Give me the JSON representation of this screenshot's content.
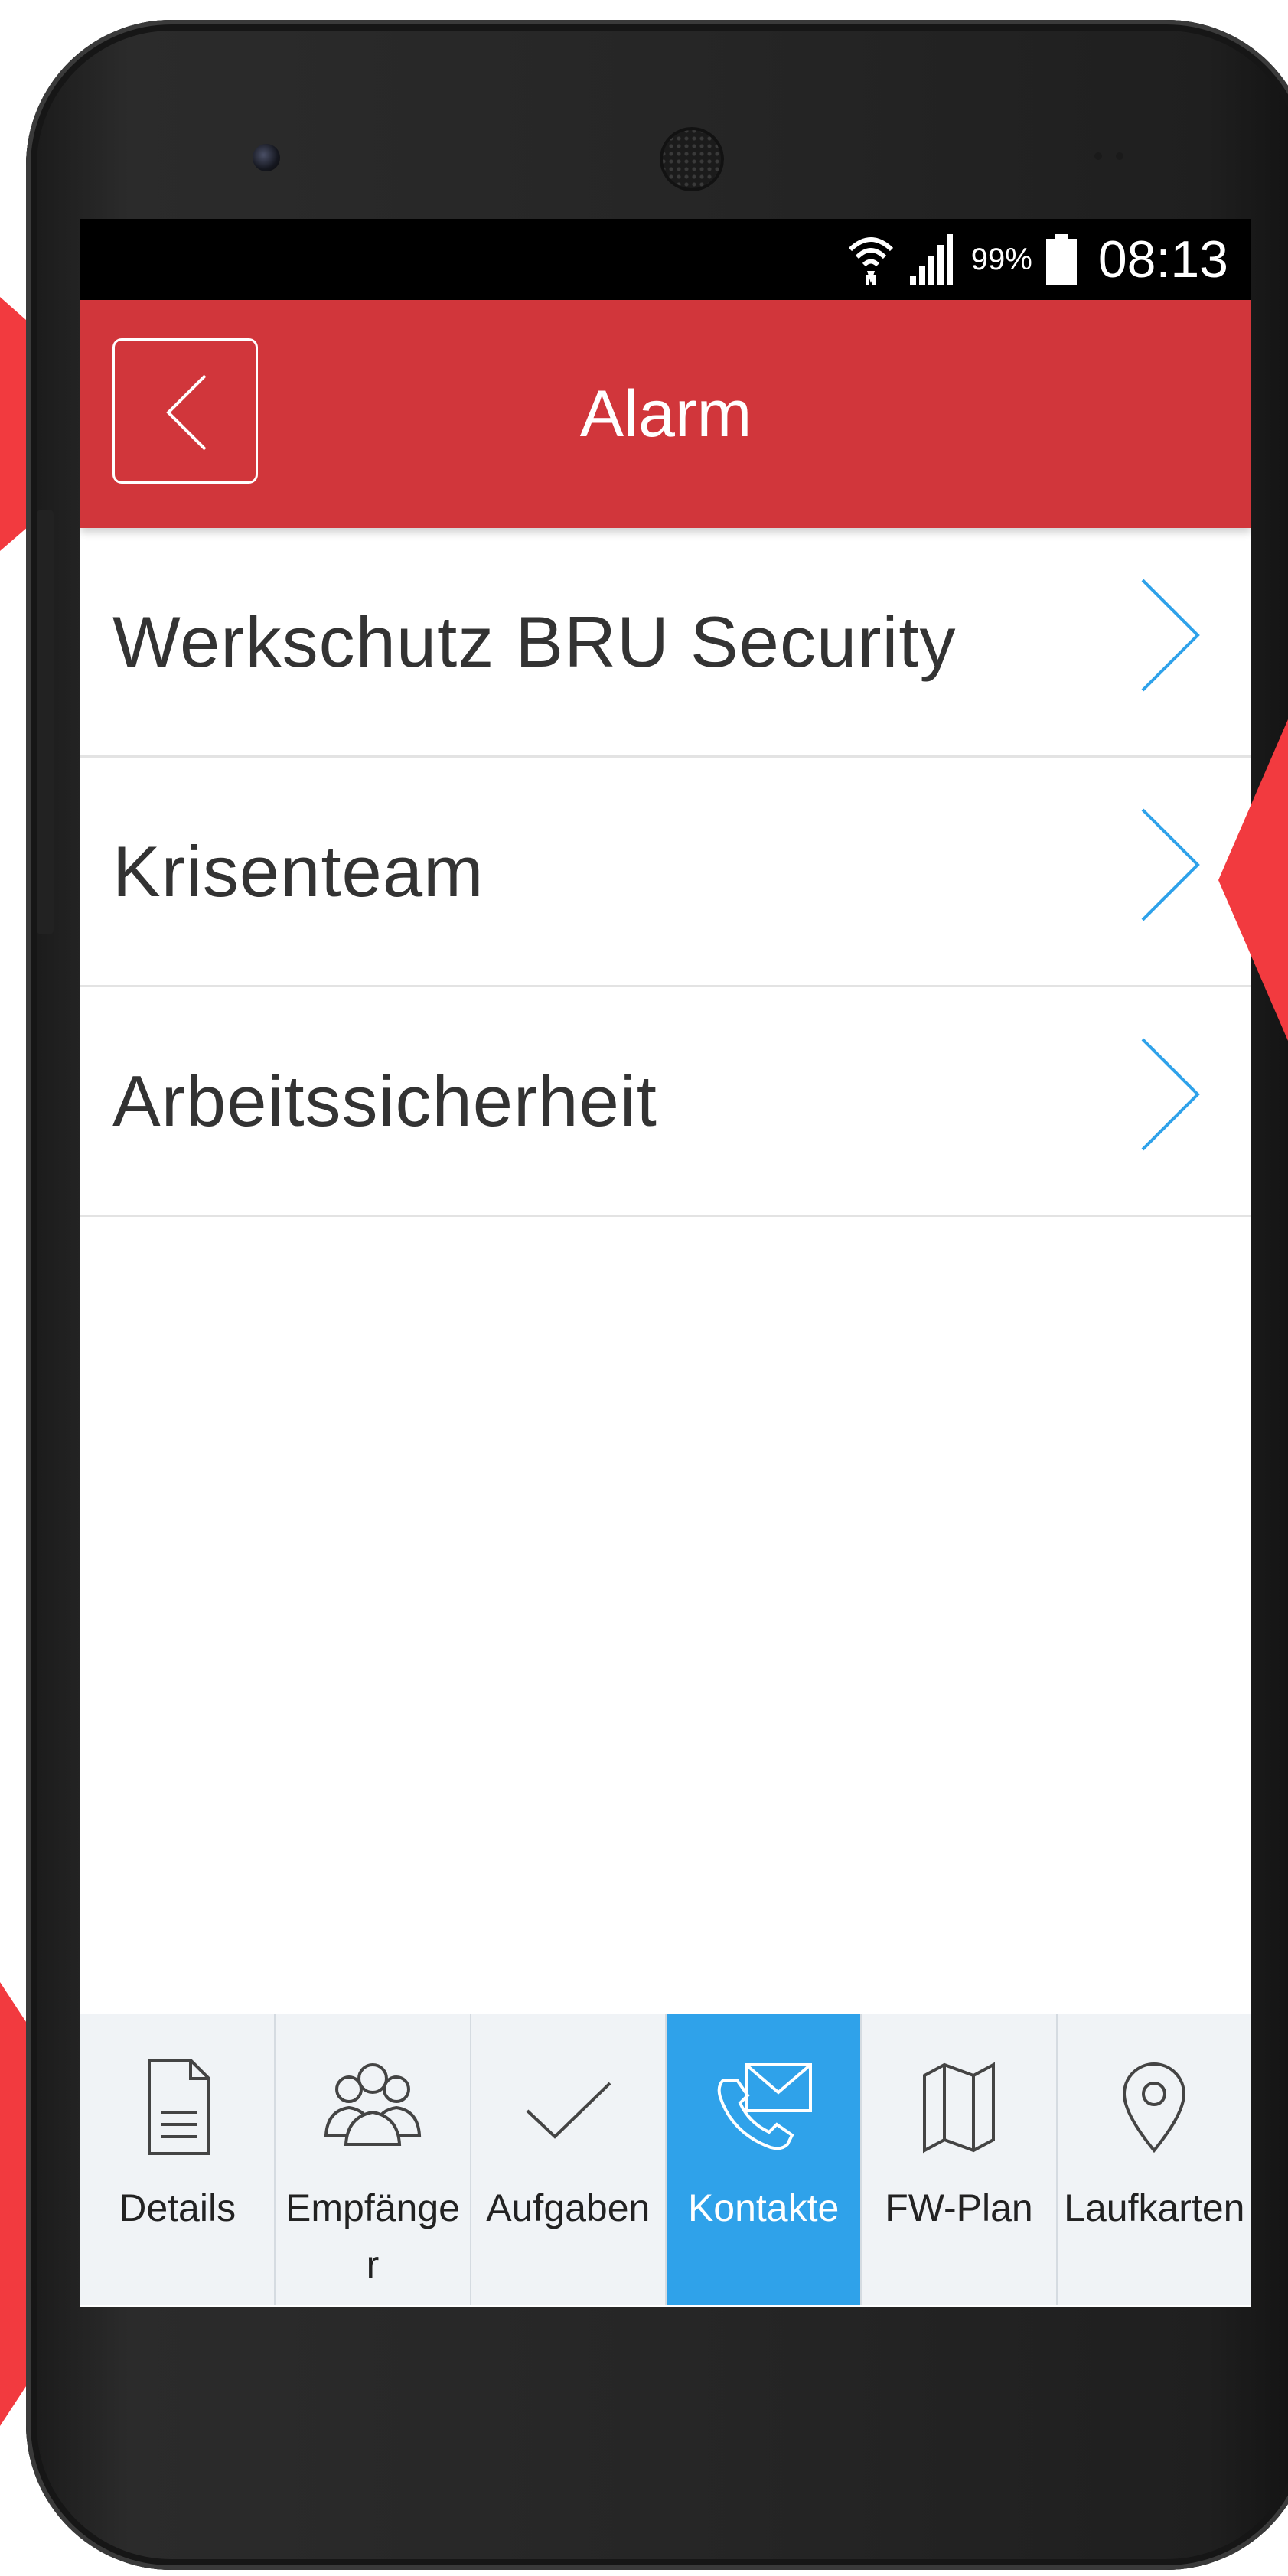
{
  "status_bar": {
    "battery_percent": "99%",
    "time": "08:13",
    "icons": [
      "wifi-icon",
      "signal-icon",
      "battery-icon"
    ]
  },
  "app_bar": {
    "title": "Alarm",
    "back_icon": "chevron-left-icon",
    "color": "#d1363b"
  },
  "list": {
    "items": [
      {
        "label": "Werkschutz BRU Security"
      },
      {
        "label": "Krisenteam"
      },
      {
        "label": "Arbeitssicherheit"
      }
    ],
    "chevron_color": "#2fa2ea"
  },
  "tabs": [
    {
      "label": "Details",
      "icon": "document-icon",
      "active": false
    },
    {
      "label": "Empfänger",
      "icon": "group-icon",
      "active": false
    },
    {
      "label": "Aufgaben",
      "icon": "checkmark-icon",
      "active": false
    },
    {
      "label": "Kontakte",
      "icon": "phone-mail-icon",
      "active": true
    },
    {
      "label": "FW-Plan",
      "icon": "map-icon",
      "active": false
    },
    {
      "label": "Laufkarten",
      "icon": "location-pin-icon",
      "active": false
    }
  ],
  "colors": {
    "accent": "#2fa2ea",
    "annotation": "#f23a3f"
  }
}
